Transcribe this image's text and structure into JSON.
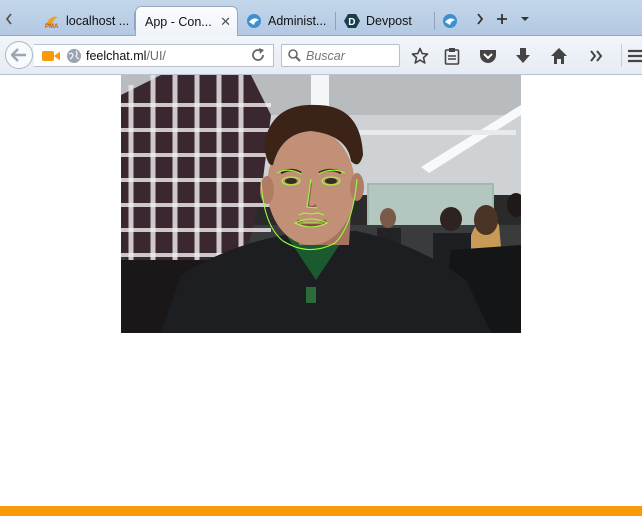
{
  "browser": {
    "tabs": [
      {
        "label": "localhost ...",
        "icon": "phpmyadmin-icon",
        "active": false
      },
      {
        "label": "App - Con...",
        "icon": "",
        "active": true
      },
      {
        "label": "Administ...",
        "icon": "mobile-service-icon",
        "active": false
      },
      {
        "label": "Devpost",
        "icon": "devpost-icon",
        "active": false
      },
      {
        "label": "",
        "icon": "mobile-service-icon",
        "active": false
      }
    ],
    "url": {
      "domain": "feelchat.ml",
      "path": "/UI/"
    },
    "search_placeholder": "Buscar"
  },
  "colors": {
    "accent_orange": "#f99a0b",
    "face_tracking_lines": "#9cff3c",
    "tab_strip": "#bcd0e6"
  },
  "page": {
    "webcam_feed": {
      "description_icon": "webcam-feed",
      "face_tracking_overlay": true
    }
  }
}
